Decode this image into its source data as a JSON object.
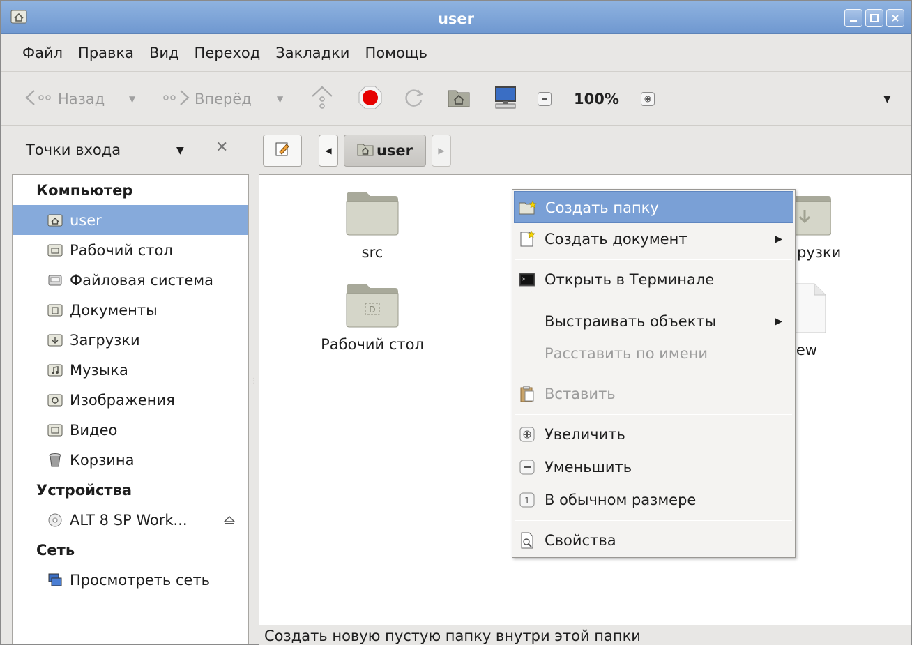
{
  "window": {
    "title": "user",
    "app_icon": "home-folder-icon",
    "controls": [
      "minimize-icon",
      "maximize-icon",
      "close-icon"
    ]
  },
  "menubar": {
    "items": [
      "Файл",
      "Правка",
      "Вид",
      "Переход",
      "Закладки",
      "Помощь"
    ]
  },
  "toolbar": {
    "back_label": "Назад",
    "forward_label": "Вперёд",
    "zoom_level": "100%"
  },
  "sidebar": {
    "header_label": "Точки входа",
    "sections": [
      {
        "heading": "Компьютер",
        "items": [
          {
            "label": "user",
            "icon": "home-icon",
            "selected": true
          },
          {
            "label": "Рабочий стол",
            "icon": "desktop-folder-icon"
          },
          {
            "label": "Файловая система",
            "icon": "drive-icon"
          },
          {
            "label": "Документы",
            "icon": "documents-folder-icon"
          },
          {
            "label": "Загрузки",
            "icon": "downloads-folder-icon"
          },
          {
            "label": "Музыка",
            "icon": "music-folder-icon"
          },
          {
            "label": "Изображения",
            "icon": "pictures-folder-icon"
          },
          {
            "label": "Видео",
            "icon": "video-folder-icon"
          },
          {
            "label": "Корзина",
            "icon": "trash-icon"
          }
        ]
      },
      {
        "heading": "Устройства",
        "items": [
          {
            "label": "ALT 8 SP Work...",
            "icon": "optical-disc-icon"
          }
        ]
      },
      {
        "heading": "Сеть",
        "items": [
          {
            "label": "Просмотреть сеть",
            "icon": "network-icon"
          }
        ]
      }
    ]
  },
  "pathbar": {
    "current": "user"
  },
  "files": [
    {
      "label": "src",
      "icon": "folder-icon"
    },
    {
      "label": "Рабочий стол",
      "icon": "desktop-folder-icon"
    },
    {
      "label": "грузки",
      "icon": "downloads-folder-icon"
    },
    {
      "label": "iew",
      "icon": "file-icon"
    }
  ],
  "context_menu": {
    "items": [
      {
        "label": "Создать папку",
        "icon": "new-folder-icon",
        "state": "active"
      },
      {
        "label": "Создать документ",
        "icon": "new-document-icon",
        "submenu": true
      },
      {
        "label": "Открыть в Терминале",
        "icon": "terminal-icon"
      },
      {
        "label": "Выстраивать объекты",
        "submenu": true
      },
      {
        "label": "Расставить по имени",
        "state": "disabled"
      },
      {
        "label": "Вставить",
        "icon": "paste-icon",
        "state": "disabled"
      },
      {
        "label": "Увеличить",
        "icon": "zoom-in-icon"
      },
      {
        "label": "Уменьшить",
        "icon": "zoom-out-icon"
      },
      {
        "label": "В обычном размере",
        "icon": "zoom-reset-icon"
      },
      {
        "label": "Свойства",
        "icon": "properties-icon"
      }
    ]
  },
  "statusbar": {
    "text": "Создать новую пустую папку внутри этой папки"
  },
  "colors": {
    "titlebar": "#7ea3d6",
    "selection": "#86aadb",
    "menu_highlight": "#7aa0d6",
    "folder": "#c7c7b9"
  }
}
